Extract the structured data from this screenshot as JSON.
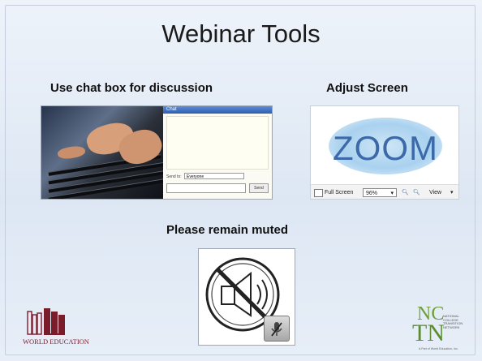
{
  "slide": {
    "title": "Webinar Tools",
    "sections": {
      "chat": {
        "label": "Use chat box for discussion"
      },
      "zoom": {
        "label": "Adjust Screen"
      },
      "mute": {
        "label": "Please remain muted"
      }
    }
  },
  "chat_window": {
    "title": "Chat",
    "send_to_label": "Send to:",
    "send_to_value": "Everyone",
    "send_button": "Send"
  },
  "zoom_panel": {
    "logo_text": "ZOOM",
    "full_screen_label": "Full Screen",
    "zoom_level": "96%",
    "view_label": "View"
  },
  "logos": {
    "world_education": "WORLD EDUCATION",
    "nctn_letters_top": "NC",
    "nctn_letters_bottom": "TN",
    "nctn_small_text": "NATIONAL\nCOLLEGE\nTRANSITION\nNETWORK",
    "nctn_footer": "A Part of World Education, Inc."
  },
  "colors": {
    "background": "#e3ebf6",
    "zoom_blue": "#3c6aa8",
    "we_maroon": "#7a1c2a",
    "nctn_green": "#6f9f3b"
  }
}
